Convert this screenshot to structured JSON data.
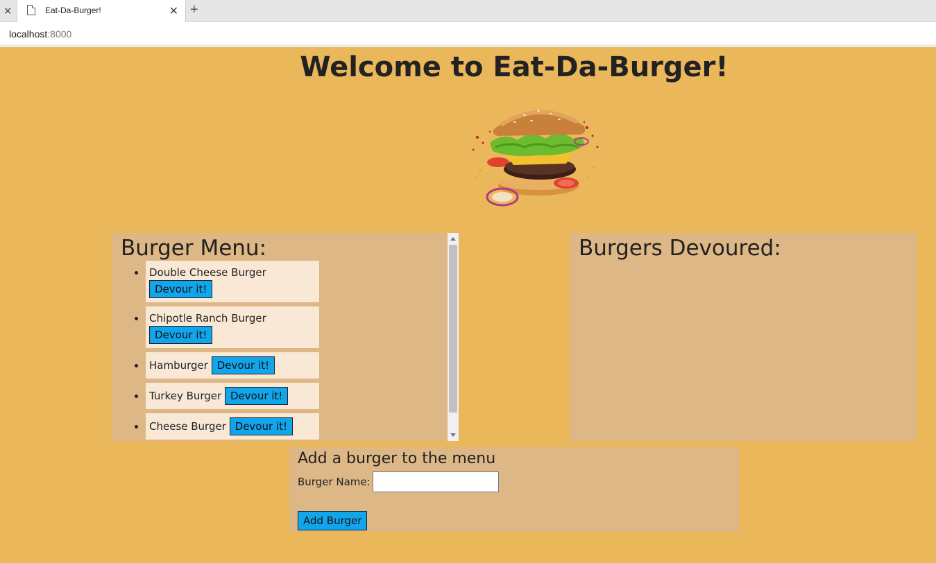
{
  "browser": {
    "tab_title": "Eat-Da-Burger!",
    "url_host": "localhost",
    "url_port": ":8000"
  },
  "page": {
    "title": "Welcome to Eat-Da-Burger!"
  },
  "menu": {
    "heading": "Burger Menu:",
    "button_label": "Devour it!",
    "items": [
      {
        "name": "Double Cheese Burger"
      },
      {
        "name": "Chipotle Ranch Burger"
      },
      {
        "name": "Hamburger"
      },
      {
        "name": "Turkey Burger"
      },
      {
        "name": "Cheese Burger"
      }
    ]
  },
  "devoured": {
    "heading": "Burgers Devoured:"
  },
  "add_form": {
    "heading": "Add a burger to the menu",
    "label": "Burger Name:",
    "input_value": "",
    "button_label": "Add Burger"
  }
}
